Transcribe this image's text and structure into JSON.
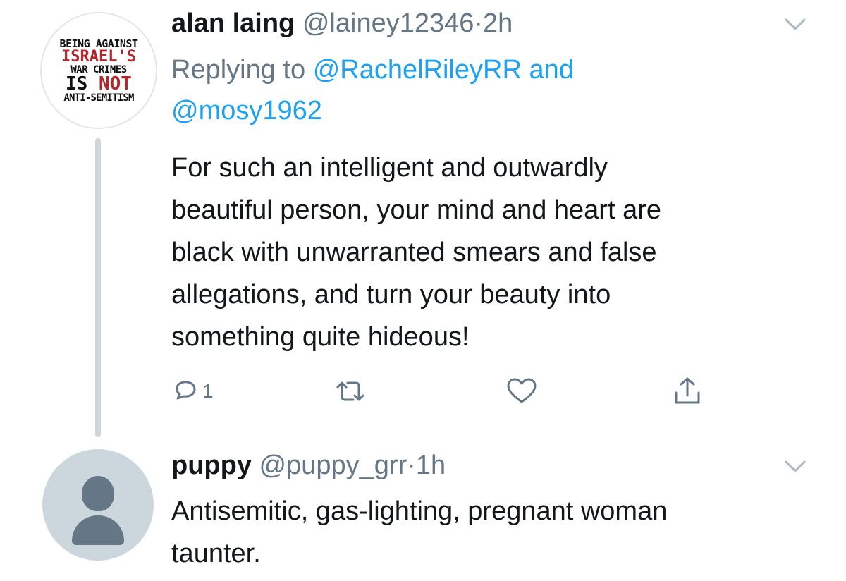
{
  "tweet1": {
    "avatar_badge": {
      "line1": "BEING AGAINST",
      "line2": "ISRAEL'S",
      "line3": "WAR CRIMES",
      "line4a": "IS",
      "line4b": "NOT",
      "line5": "ANTI-SEMITISM"
    },
    "display_name": "alan laing",
    "handle": "@lainey12346",
    "separator": "·",
    "time": "2h",
    "replying_prefix": "Replying to",
    "replying_mention_1": "@RachelRileyRR",
    "replying_and": "and",
    "replying_mention_2": "@mosy1962",
    "text_lines": [
      "For such an intelligent and outwardly",
      "beautiful person, your mind and heart are",
      "black with unwarranted smears and false",
      "allegations, and turn your beauty into",
      "something quite hideous!"
    ],
    "actions": {
      "reply_count": "1",
      "reply_icon": "reply-icon",
      "retweet_icon": "retweet-icon",
      "like_icon": "heart-icon",
      "share_icon": "share-icon"
    }
  },
  "tweet2": {
    "display_name": "puppy",
    "handle": "@puppy_grr",
    "separator": "·",
    "time": "1h",
    "text_lines": [
      "Antisemitic, gas-lighting, pregnant woman",
      "taunter."
    ]
  },
  "colors": {
    "text": "#14171a",
    "secondary": "#657786",
    "link": "#1da1f2",
    "thread_line": "#cdd5dc",
    "default_avatar_bg": "#ccd6dd"
  }
}
